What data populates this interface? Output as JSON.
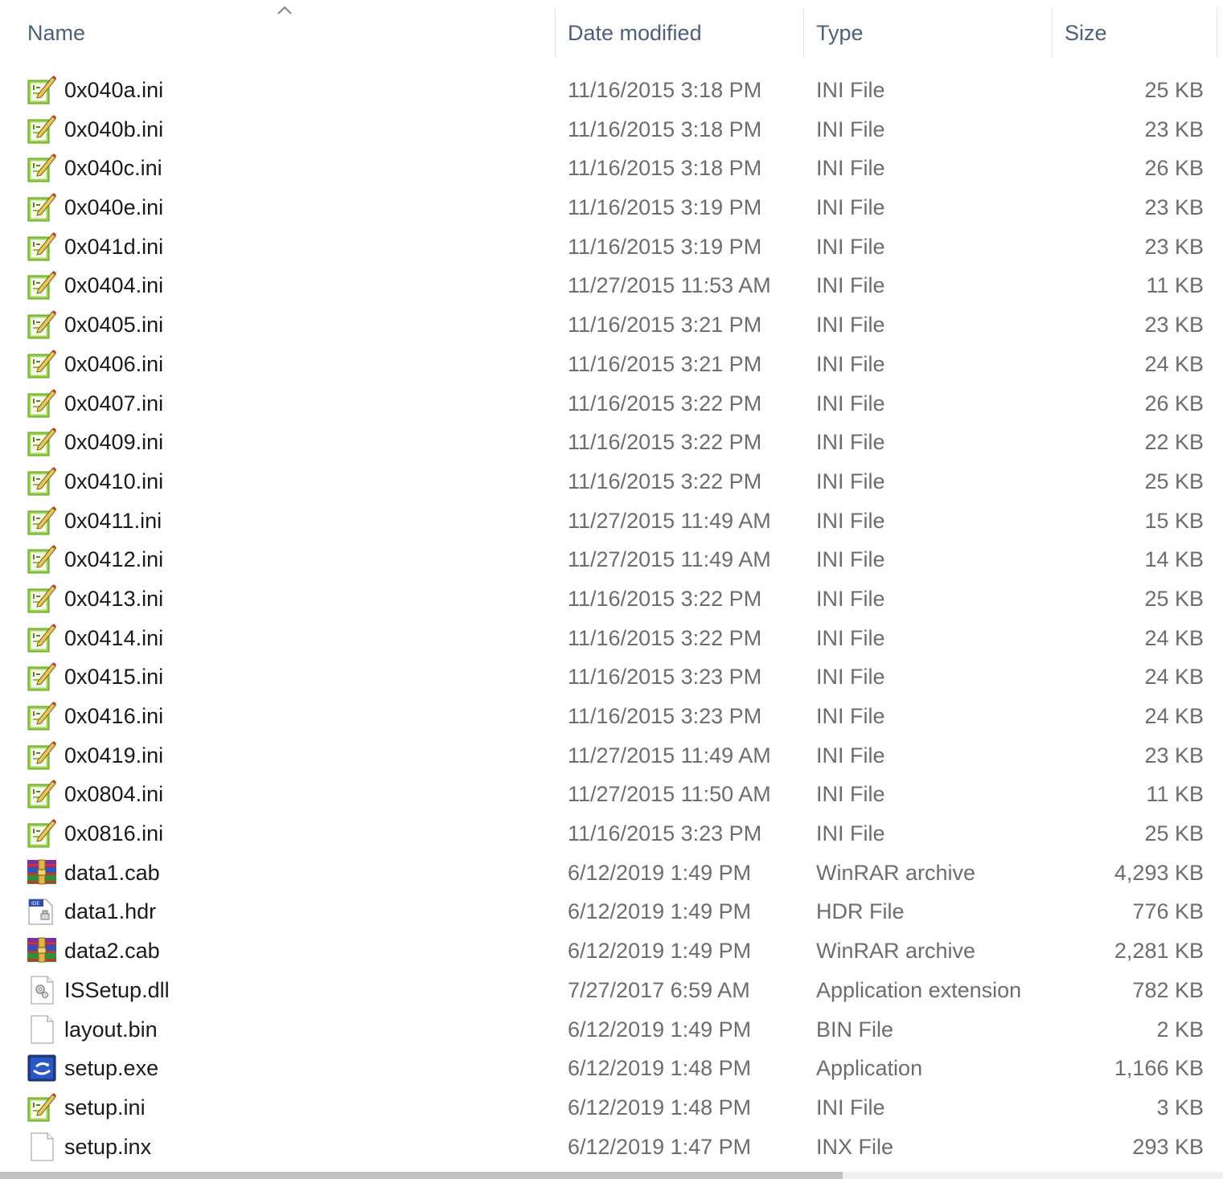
{
  "columns": {
    "name": "Name",
    "date_modified": "Date modified",
    "type": "Type",
    "size": "Size"
  },
  "sort": {
    "column": "name",
    "direction": "ascending",
    "indicator_icon": "chevron-up-icon"
  },
  "files": [
    {
      "name": "0x040a.ini",
      "date": "11/16/2015 3:18 PM",
      "type": "INI File",
      "size": "25 KB",
      "icon": "ini"
    },
    {
      "name": "0x040b.ini",
      "date": "11/16/2015 3:18 PM",
      "type": "INI File",
      "size": "23 KB",
      "icon": "ini"
    },
    {
      "name": "0x040c.ini",
      "date": "11/16/2015 3:18 PM",
      "type": "INI File",
      "size": "26 KB",
      "icon": "ini"
    },
    {
      "name": "0x040e.ini",
      "date": "11/16/2015 3:19 PM",
      "type": "INI File",
      "size": "23 KB",
      "icon": "ini"
    },
    {
      "name": "0x041d.ini",
      "date": "11/16/2015 3:19 PM",
      "type": "INI File",
      "size": "23 KB",
      "icon": "ini"
    },
    {
      "name": "0x0404.ini",
      "date": "11/27/2015 11:53 AM",
      "type": "INI File",
      "size": "11 KB",
      "icon": "ini"
    },
    {
      "name": "0x0405.ini",
      "date": "11/16/2015 3:21 PM",
      "type": "INI File",
      "size": "23 KB",
      "icon": "ini"
    },
    {
      "name": "0x0406.ini",
      "date": "11/16/2015 3:21 PM",
      "type": "INI File",
      "size": "24 KB",
      "icon": "ini"
    },
    {
      "name": "0x0407.ini",
      "date": "11/16/2015 3:22 PM",
      "type": "INI File",
      "size": "26 KB",
      "icon": "ini"
    },
    {
      "name": "0x0409.ini",
      "date": "11/16/2015 3:22 PM",
      "type": "INI File",
      "size": "22 KB",
      "icon": "ini"
    },
    {
      "name": "0x0410.ini",
      "date": "11/16/2015 3:22 PM",
      "type": "INI File",
      "size": "25 KB",
      "icon": "ini"
    },
    {
      "name": "0x0411.ini",
      "date": "11/27/2015 11:49 AM",
      "type": "INI File",
      "size": "15 KB",
      "icon": "ini"
    },
    {
      "name": "0x0412.ini",
      "date": "11/27/2015 11:49 AM",
      "type": "INI File",
      "size": "14 KB",
      "icon": "ini"
    },
    {
      "name": "0x0413.ini",
      "date": "11/16/2015 3:22 PM",
      "type": "INI File",
      "size": "25 KB",
      "icon": "ini"
    },
    {
      "name": "0x0414.ini",
      "date": "11/16/2015 3:22 PM",
      "type": "INI File",
      "size": "24 KB",
      "icon": "ini"
    },
    {
      "name": "0x0415.ini",
      "date": "11/16/2015 3:23 PM",
      "type": "INI File",
      "size": "24 KB",
      "icon": "ini"
    },
    {
      "name": "0x0416.ini",
      "date": "11/16/2015 3:23 PM",
      "type": "INI File",
      "size": "24 KB",
      "icon": "ini"
    },
    {
      "name": "0x0419.ini",
      "date": "11/27/2015 11:49 AM",
      "type": "INI File",
      "size": "23 KB",
      "icon": "ini"
    },
    {
      "name": "0x0804.ini",
      "date": "11/27/2015 11:50 AM",
      "type": "INI File",
      "size": "11 KB",
      "icon": "ini"
    },
    {
      "name": "0x0816.ini",
      "date": "11/16/2015 3:23 PM",
      "type": "INI File",
      "size": "25 KB",
      "icon": "ini"
    },
    {
      "name": "data1.cab",
      "date": "6/12/2019 1:49 PM",
      "type": "WinRAR archive",
      "size": "4,293 KB",
      "icon": "winrar"
    },
    {
      "name": "data1.hdr",
      "date": "6/12/2019 1:49 PM",
      "type": "HDR File",
      "size": "776 KB",
      "icon": "hdr"
    },
    {
      "name": "data2.cab",
      "date": "6/12/2019 1:49 PM",
      "type": "WinRAR archive",
      "size": "2,281 KB",
      "icon": "winrar"
    },
    {
      "name": "ISSetup.dll",
      "date": "7/27/2017 6:59 AM",
      "type": "Application extension",
      "size": "782 KB",
      "icon": "dll"
    },
    {
      "name": "layout.bin",
      "date": "6/12/2019 1:49 PM",
      "type": "BIN File",
      "size": "2 KB",
      "icon": "blank"
    },
    {
      "name": "setup.exe",
      "date": "6/12/2019 1:48 PM",
      "type": "Application",
      "size": "1,166 KB",
      "icon": "exe"
    },
    {
      "name": "setup.ini",
      "date": "6/12/2019 1:48 PM",
      "type": "INI File",
      "size": "3 KB",
      "icon": "ini"
    },
    {
      "name": "setup.inx",
      "date": "6/12/2019 1:47 PM",
      "type": "INX File",
      "size": "293 KB",
      "icon": "blank"
    }
  ],
  "colors": {
    "header_text": "#4c6079",
    "name_text": "#1a1a1a",
    "meta_text": "#6d6d6d"
  }
}
